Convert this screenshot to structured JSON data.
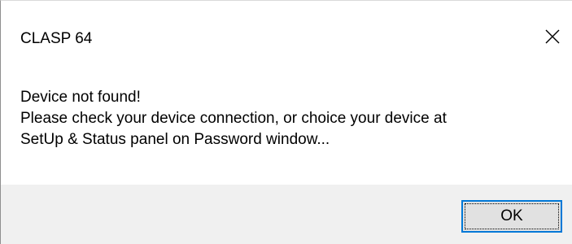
{
  "window": {
    "title": "CLASP 64",
    "close_icon": "close-icon"
  },
  "message": {
    "lines": [
      "Device not found!",
      "Please check your device connection, or choice your device at",
      "SetUp & Status panel on Password window..."
    ]
  },
  "buttons": {
    "ok_label": "OK"
  },
  "colors": {
    "background": "#ffffff",
    "footer": "#f0f0f0",
    "button_face": "#e1e1e1",
    "button_focus_border": "#0078d7"
  }
}
